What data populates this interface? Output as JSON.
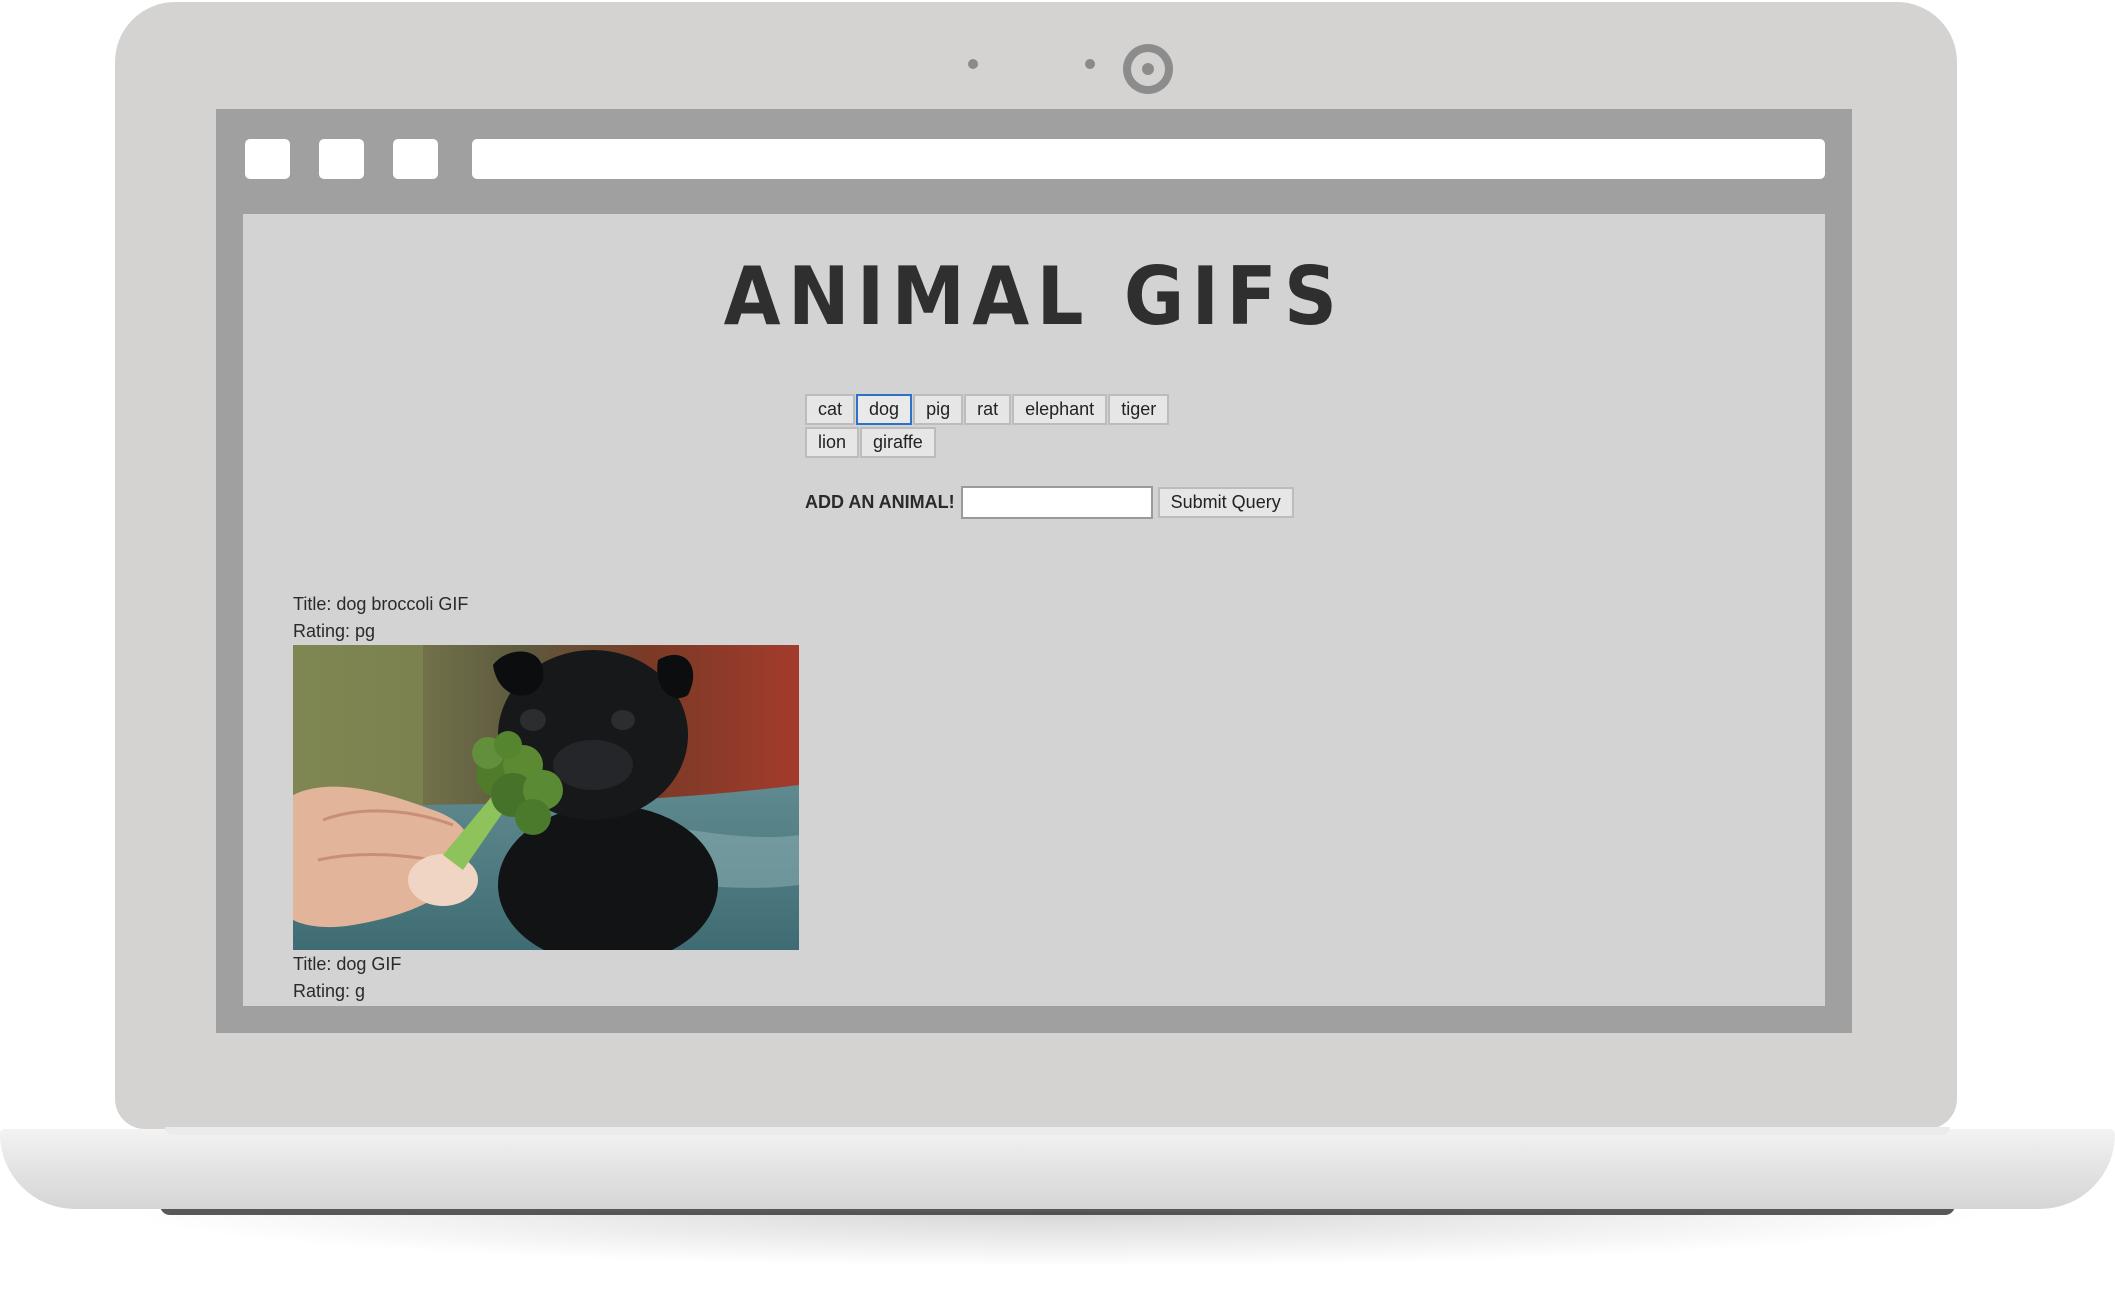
{
  "page": {
    "title": "ANIMAL GIFS"
  },
  "animal_buttons": [
    "cat",
    "dog",
    "pig",
    "rat",
    "elephant",
    "tiger",
    "lion",
    "giraffe"
  ],
  "focused_button": "dog",
  "form": {
    "label": "ADD AN ANIMAL!",
    "input_value": "",
    "submit_label": "Submit Query"
  },
  "results": [
    {
      "title": "Title: dog broccoli GIF",
      "rating": "Rating: pg",
      "image_icon": "pug-eating-broccoli-image"
    },
    {
      "title": "Title: dog GIF",
      "rating": "Rating: g"
    }
  ],
  "colors": {
    "lid": "#d4d3d2",
    "browser_frame": "#a0a0a0",
    "page_background": "#d3d3d3",
    "focus_ring": "#2b72c8",
    "title_text": "#2f2f2f"
  }
}
